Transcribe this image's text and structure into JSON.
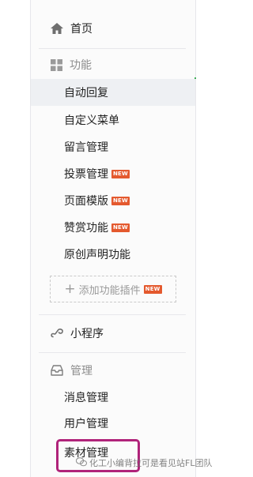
{
  "sidebar": {
    "home": {
      "label": "首页",
      "icon": "home-icon"
    },
    "features": {
      "header": "功能",
      "icon": "grid-icon",
      "items": [
        {
          "label": "自动回复",
          "active": true
        },
        {
          "label": "自定义菜单"
        },
        {
          "label": "留言管理"
        },
        {
          "label": "投票管理",
          "badge": "NEW"
        },
        {
          "label": "页面模版",
          "badge": "NEW"
        },
        {
          "label": "赞赏功能",
          "badge": "NEW"
        },
        {
          "label": "原创声明功能"
        }
      ],
      "add_plugin": {
        "label": "添加功能插件",
        "badge": "NEW"
      }
    },
    "mini_program": {
      "label": "小程序",
      "icon": "mini-program-icon"
    },
    "management": {
      "header": "管理",
      "icon": "tray-icon",
      "items": [
        {
          "label": "消息管理"
        },
        {
          "label": "用户管理"
        },
        {
          "label": "素材管理",
          "highlighted": true
        }
      ]
    }
  },
  "watermark": {
    "text": "化工小编背拉可是看见站FL团队"
  },
  "colors": {
    "badge": "#e4592e",
    "highlight": "#b0237a",
    "active_row": "#eef0f3"
  }
}
